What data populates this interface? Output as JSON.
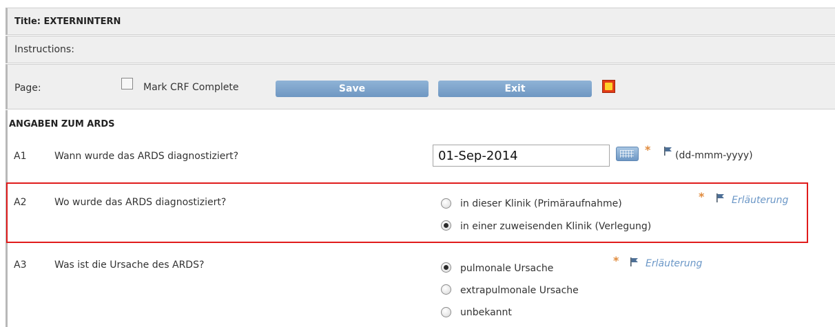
{
  "header": {
    "title": "Title: EXTERNINTERN",
    "instructions": "Instructions:"
  },
  "toolbar": {
    "page_label": "Page:",
    "mark_complete_label": "Mark CRF Complete",
    "mark_complete_checked": false,
    "save_label": "Save",
    "exit_label": "Exit",
    "notes_icon": "notes-icon"
  },
  "section": {
    "title": "ANGABEN ZUM ARDS"
  },
  "questions": [
    {
      "num": "A1",
      "text": "Wann wurde das ARDS diagnostiziert?",
      "value": "01-Sep-2014",
      "required_marker": "*",
      "format_hint": "(dd-mmm-yyyy)"
    },
    {
      "num": "A2",
      "text": "Wo wurde das ARDS diagnostiziert?",
      "required_marker": "*",
      "explain_link": "Erläuterung",
      "options": [
        {
          "label": "in dieser Klinik (Primäraufnahme)",
          "checked": false
        },
        {
          "label": "in einer zuweisenden Klinik (Verlegung)",
          "checked": true
        }
      ]
    },
    {
      "num": "A3",
      "text": "Was ist die Ursache des ARDS?",
      "required_marker": "*",
      "explain_link": "Erläuterung",
      "options": [
        {
          "label": "pulmonale Ursache",
          "checked": true
        },
        {
          "label": "extrapulmonale Ursache",
          "checked": false
        },
        {
          "label": "unbekannt",
          "checked": false
        }
      ]
    }
  ],
  "colors": {
    "button": "#7ea5cc",
    "highlight_border": "#e01b1b",
    "required_star": "#e08a3c",
    "link": "#6b97c7"
  }
}
